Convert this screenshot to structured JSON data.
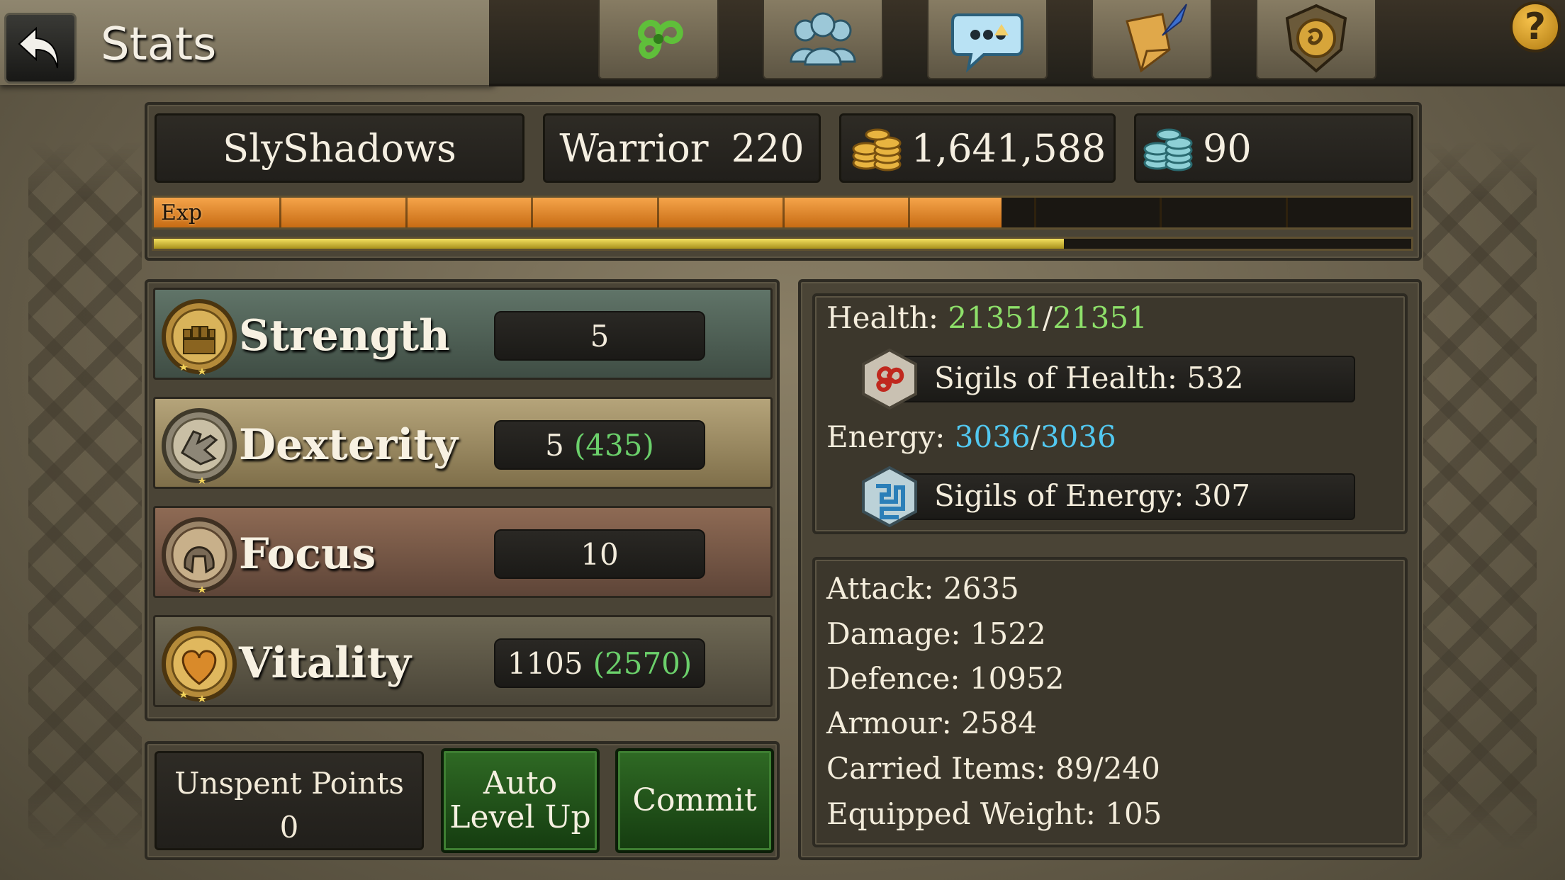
{
  "header": {
    "title": "Stats",
    "nav_icons": [
      "triskele-icon",
      "guild-members-icon",
      "chat-bubble-icon",
      "quest-scroll-icon",
      "shield-crest-icon"
    ],
    "help_label": "?"
  },
  "player": {
    "name": "SlyShadows",
    "class": "Warrior",
    "level": "220",
    "gold": "1,641,588",
    "gems": "90"
  },
  "exp": {
    "label": "Exp",
    "progress": 0.674,
    "sub_progress": 0.724
  },
  "attributes": [
    {
      "name": "Strength",
      "value": "5",
      "bonus": "",
      "icon": "fist-icon"
    },
    {
      "name": "Dexterity",
      "value": "5",
      "bonus": "(435)",
      "icon": "gauntlet-icon"
    },
    {
      "name": "Focus",
      "value": "10",
      "bonus": "",
      "icon": "helmet-icon"
    },
    {
      "name": "Vitality",
      "value": "1105",
      "bonus": "(2570)",
      "icon": "heart-icon"
    }
  ],
  "unspent": {
    "label": "Unspent Points",
    "value": "0"
  },
  "buttons": {
    "auto_level_line1": "Auto",
    "auto_level_line2": "Level Up",
    "commit": "Commit"
  },
  "health": {
    "label": "Health: ",
    "current": "21351",
    "sep": "/",
    "max": "21351",
    "sigils_label": "Sigils of Health: 532"
  },
  "energy": {
    "label": "Energy: ",
    "current": "3036",
    "sep": "/",
    "max": "3036",
    "sigils_label": "Sigils of Energy: 307"
  },
  "combat": [
    "Attack: 2635",
    "Damage: 1522",
    "Defence: 10952",
    "Armour: 2584",
    "Carried Items: 89/240",
    "Equipped Weight: 105"
  ],
  "colors": {
    "exp_orange": "#e88a2c",
    "exp_yellow": "#e8d24a",
    "health_green": "#8ee06a",
    "energy_blue": "#52c8f0",
    "button_green": "#2f6a24"
  }
}
